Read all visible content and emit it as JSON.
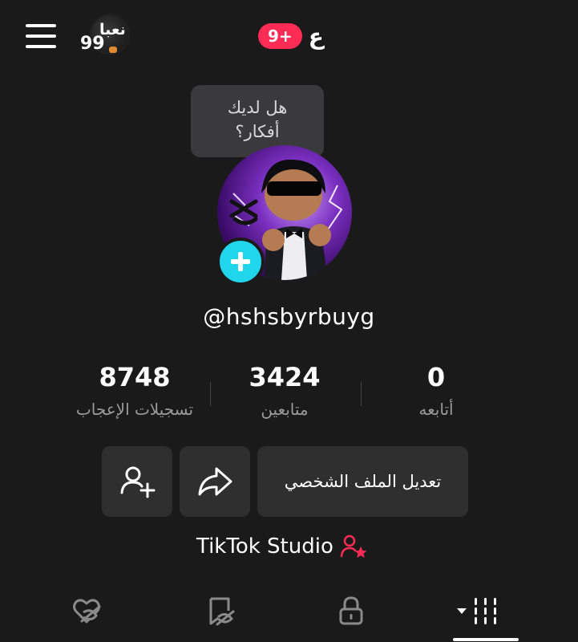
{
  "header": {
    "avatar_word": "نعبا",
    "avatar_number": "99",
    "notification_badge": "9+",
    "notification_letter": "ع"
  },
  "tooltip": {
    "line1": "هل لديك",
    "line2": "أفكار؟"
  },
  "profile": {
    "username": "@hshsbyrbuyg"
  },
  "stats": {
    "likes": {
      "value": "8748",
      "label": "تسجيلات الإعجاب"
    },
    "followers": {
      "value": "3424",
      "label": "متابعين"
    },
    "following": {
      "value": "0",
      "label": "أتابعه"
    }
  },
  "actions": {
    "edit_profile": "تعديل الملف الشخصي"
  },
  "studio": {
    "label": "TikTok Studio"
  },
  "colors": {
    "background": "#1a1a1a",
    "accent": "#fe2c55",
    "plus": "#20d5ec",
    "button": "#2f2f2f"
  },
  "tabs": [
    {
      "icon": "liked-heart-hidden-icon"
    },
    {
      "icon": "favorites-hidden-icon"
    },
    {
      "icon": "lock-icon"
    },
    {
      "icon": "videos-grid-icon",
      "selected": true
    }
  ]
}
